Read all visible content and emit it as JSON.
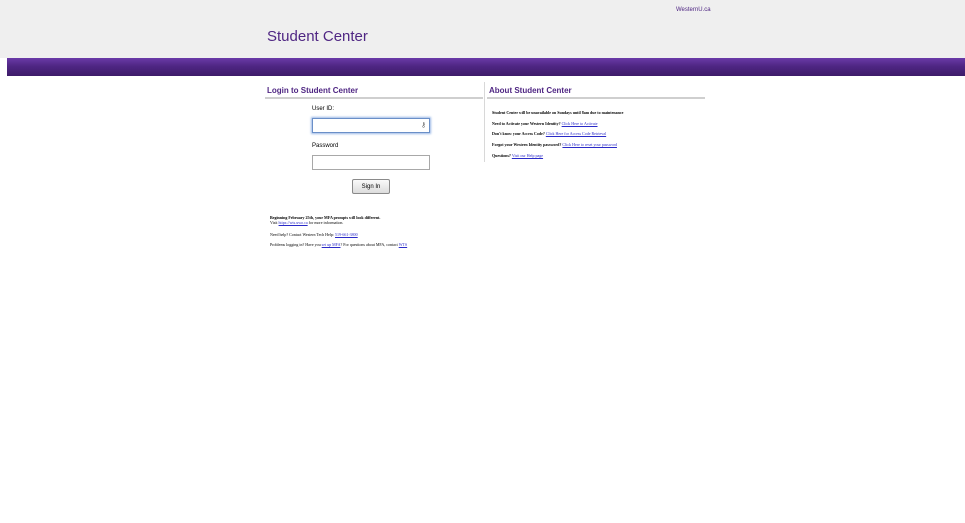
{
  "header": {
    "top_link": "WesternU.ca",
    "site_title": "Student Center",
    "brand_color": "#4f2683"
  },
  "login": {
    "heading": "Login to Student Center",
    "userid_label": "User ID:",
    "userid_value": "",
    "userid_icon": "key-icon",
    "password_label": "Password",
    "password_value": "",
    "signin_label": "Sign In"
  },
  "notices": {
    "line1_bold": "Beginning February 25th, your MFA prompts will look different.",
    "line1_sub_prefix": "Visit ",
    "line1_sub_link": "https://wts.uwo.ca",
    "line1_sub_suffix": " for more information.",
    "line2_prefix": "Need help? Contact Western Tech Help: ",
    "line2_link": "519-661-3800",
    "line3_prefix": "Problems logging in? Have you ",
    "line3_link1": "set up MFA",
    "line3_mid": "? For questions about MFA, contact ",
    "line3_link2": "WTS"
  },
  "about": {
    "heading": "About Student Center",
    "line1": "Student Center will be unavailable on Sundays until 8am due to maintenance",
    "line2_bold": "Need to Activate your Western Identity?",
    "line2_link": "Click Here to Activate",
    "line3_bold": "Don't know your Access Code?",
    "line3_link": "Click Here for Access Code Retrieval",
    "line4_bold": "Forgot your Western Identity password?",
    "line4_link": "Click Here to reset your password",
    "line5_bold": "Questions?",
    "line5_link": "Visit our Help page"
  }
}
